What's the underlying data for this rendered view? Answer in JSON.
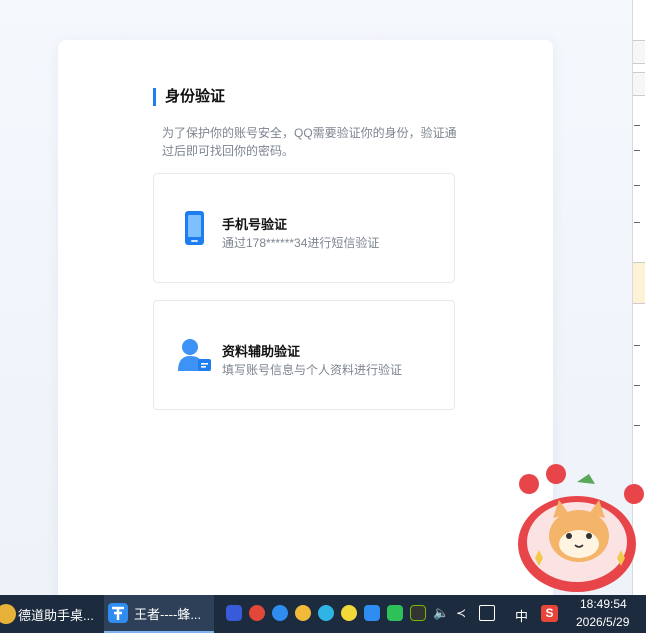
{
  "page": {
    "title": "身份验证",
    "description": "为了保护你的账号安全，QQ需要验证你的身份，验证通过后即可找回你的密码。"
  },
  "options": [
    {
      "title": "手机号验证",
      "subtitle": "通过178******34进行短信验证",
      "icon": "phone-icon"
    },
    {
      "title": "资料辅助验证",
      "subtitle": "填写账号信息与个人资料进行验证",
      "icon": "user-profile-icon"
    }
  ],
  "taskbar": {
    "apps": [
      {
        "label": "德道助手桌...",
        "icon": "assistant-app-icon"
      },
      {
        "label": "王者----蜂...",
        "icon": "game-app-icon"
      }
    ],
    "ime_label": "中",
    "time": "18:49:54",
    "date": "2026/5/29"
  },
  "colors": {
    "accent": "#1e7ef0",
    "taskbar": "#1c2b3d"
  }
}
